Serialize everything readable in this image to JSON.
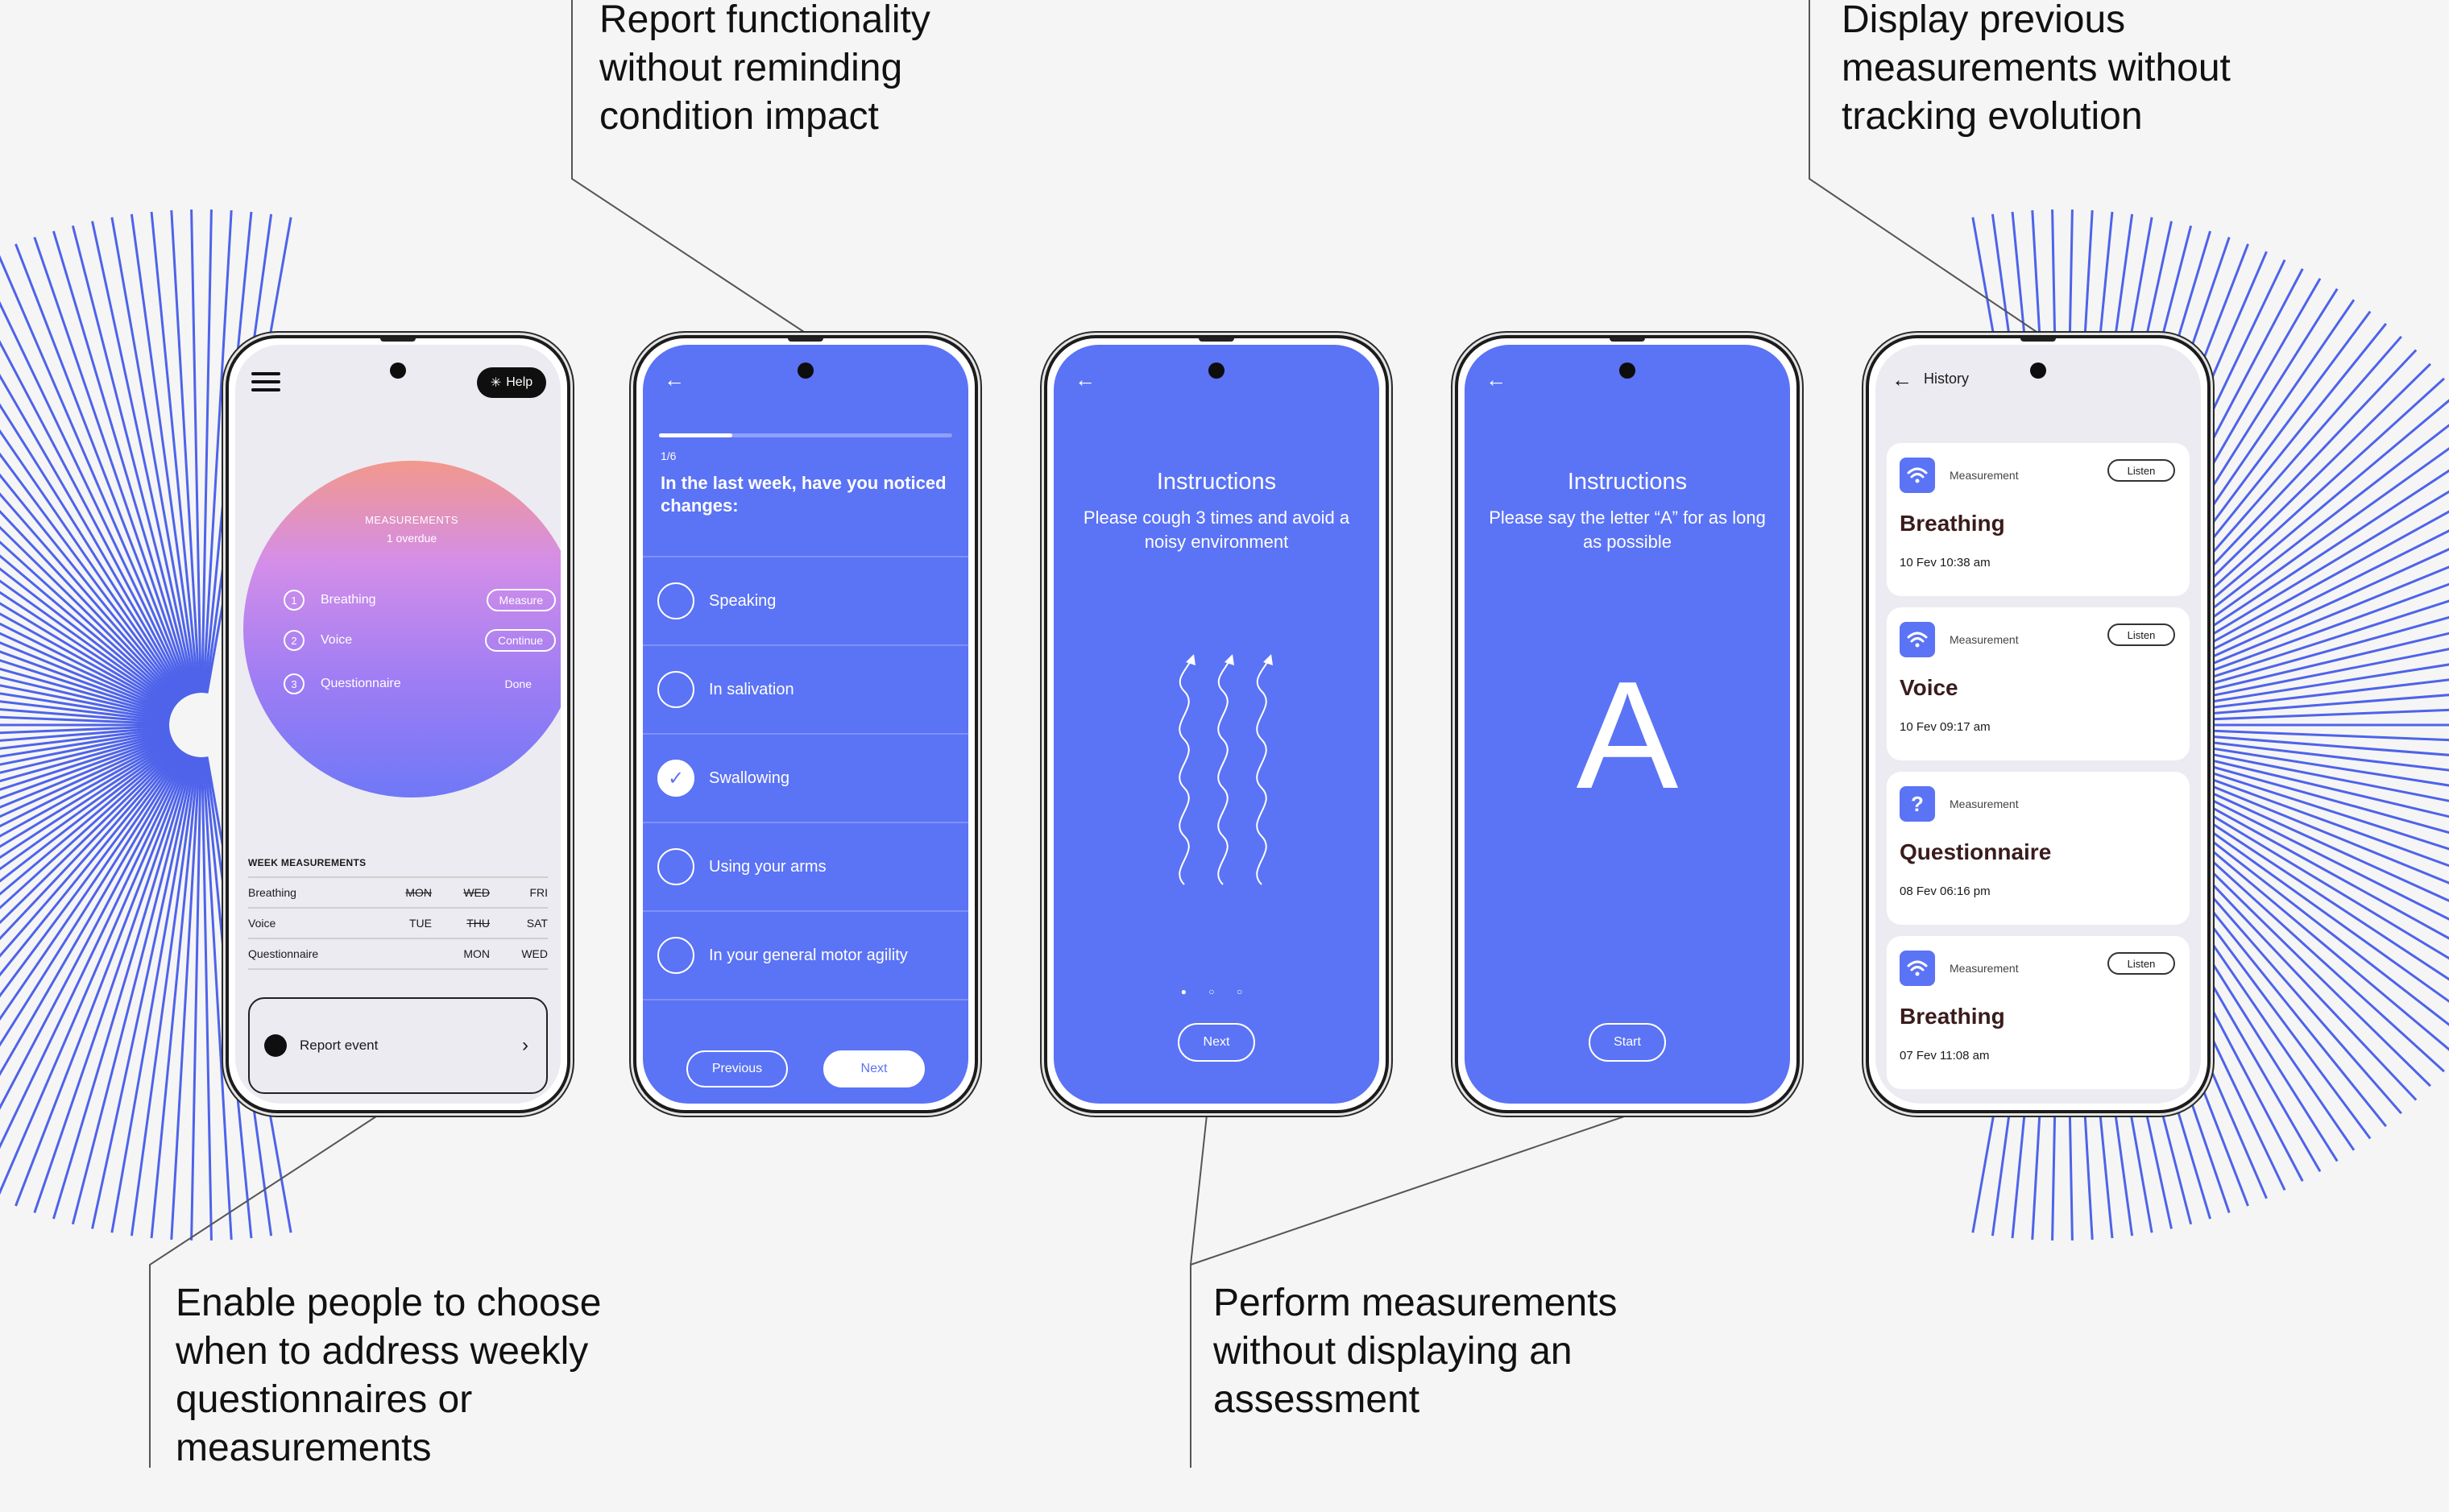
{
  "annotations": {
    "top_center": [
      "Report functionality",
      "without reminding",
      "condition impact"
    ],
    "top_right": [
      "Display previous",
      "measurements without",
      "tracking evolution"
    ],
    "bottom_left": [
      "Enable people to choose",
      "when to address weekly",
      "questionnaires or",
      "measurements"
    ],
    "bottom_center": [
      "Perform measurements",
      "without displaying an",
      "assessment"
    ]
  },
  "home": {
    "help_label": "Help",
    "measurements_title": "MEASUREMENTS",
    "overdue": "1 overdue",
    "items": [
      {
        "num": "1",
        "label": "Breathing",
        "action": "Measure"
      },
      {
        "num": "2",
        "label": "Voice",
        "action": "Continue"
      },
      {
        "num": "3",
        "label": "Questionnaire",
        "action": "Done"
      }
    ],
    "week_title": "WEEK MEASUREMENTS",
    "week_rows": [
      {
        "name": "Breathing",
        "days": [
          "MON",
          "WED",
          "FRI"
        ],
        "struck": [
          true,
          true,
          false
        ]
      },
      {
        "name": "Voice",
        "days": [
          "TUE",
          "THU",
          "SAT"
        ],
        "struck": [
          false,
          true,
          false
        ]
      },
      {
        "name": "Questionnaire",
        "days": [
          "",
          "MON",
          "WED"
        ],
        "struck": [
          false,
          false,
          false
        ]
      }
    ],
    "report_label": "Report event",
    "report_chevron": "›"
  },
  "question": {
    "step": "1/6",
    "progress": 0.25,
    "text": "In the last week, have you noticed changes:",
    "options": [
      {
        "label": "Speaking",
        "checked": false
      },
      {
        "label": "In salivation",
        "checked": false
      },
      {
        "label": "Swallowing",
        "checked": true
      },
      {
        "label": "Using your arms",
        "checked": false
      },
      {
        "label": "In your general motor agility",
        "checked": false
      }
    ],
    "previous_label": "Previous",
    "next_label": "Next"
  },
  "cough": {
    "title": "Instructions",
    "text": "Please cough 3 times and avoid a noisy environment",
    "dots": "● ○ ○",
    "button": "Next"
  },
  "voice": {
    "title": "Instructions",
    "text": "Please say the letter “A” for as long as possible",
    "letter": "A",
    "button": "Start"
  },
  "history": {
    "title": "History",
    "cards": [
      {
        "tag": "Measurement",
        "name": "Breathing",
        "date": "10 Fev 10:38 am",
        "listen": "Listen",
        "icon": "wifi-icon"
      },
      {
        "tag": "Measurement",
        "name": "Voice",
        "date": "10 Fev 09:17 am",
        "listen": "Listen",
        "icon": "wifi-icon"
      },
      {
        "tag": "Measurement",
        "name": "Questionnaire",
        "date": "08 Fev 06:16 pm",
        "listen": "",
        "icon": "question-icon"
      },
      {
        "tag": "Measurement",
        "name": "Breathing",
        "date": "07 Fev 11:08 am",
        "listen": "Listen",
        "icon": "wifi-icon"
      }
    ]
  },
  "colors": {
    "accent": "#5b73f5",
    "background": "#f5f5f5",
    "rays": "#4e63ea"
  }
}
